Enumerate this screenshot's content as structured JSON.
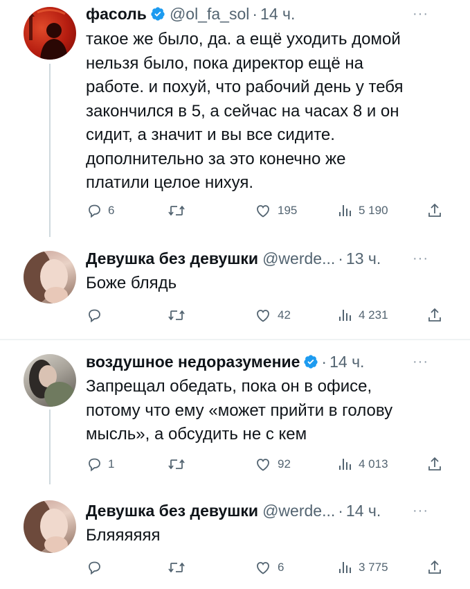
{
  "colors": {
    "text": "#0f1419",
    "secondary": "#536471",
    "verified": "#1d9bf0",
    "divider": "#eff3f4"
  },
  "tweets": [
    {
      "name": "фасоль",
      "verified": true,
      "handle": "@ol_fa_sol",
      "time": "14 ч.",
      "lines": [
        "такое же было, да. а ещё уходить домой",
        "нельзя было, пока директор ещё на",
        "работе. и похуй, что рабочий день у тебя",
        "закончился в 5, а сейчас на часах 8 и он",
        "сидит, а значит и вы все сидите.",
        "дополнительно за это конечно же",
        "платили целое нихуя."
      ],
      "replies": "6",
      "retweets": "",
      "likes": "195",
      "views": "5 190"
    },
    {
      "name": "Девушка без девушки",
      "verified": false,
      "handle": "@werde...",
      "time": "13 ч.",
      "lines": [
        "Боже блядь"
      ],
      "replies": "",
      "retweets": "",
      "likes": "42",
      "views": "4 231"
    },
    {
      "name": "воздушное недоразумение",
      "verified": true,
      "handle": "",
      "time": "14 ч.",
      "lines": [
        "Запрещал обедать, пока он в офисе,",
        "потому что ему «может прийти в голову",
        "мысль», а обсудить не с кем"
      ],
      "replies": "1",
      "retweets": "",
      "likes": "92",
      "views": "4 013"
    },
    {
      "name": "Девушка без девушки",
      "verified": false,
      "handle": "@werde...",
      "time": "14 ч.",
      "lines": [
        "Бляяяяяя"
      ],
      "replies": "",
      "retweets": "",
      "likes": "6",
      "views": "3 775"
    }
  ],
  "icons": {
    "reply": "reply-icon",
    "retweet": "retweet-icon",
    "like": "heart-icon",
    "views": "views-icon",
    "share": "share-icon",
    "more": "more-icon",
    "verified": "verified-badge-icon"
  },
  "more_glyph": "···",
  "separator": "·"
}
